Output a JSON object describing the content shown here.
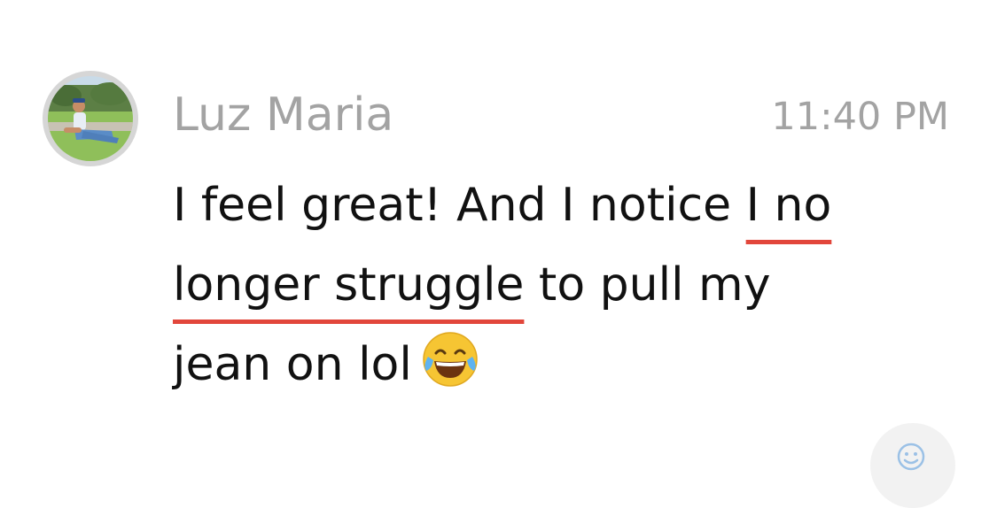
{
  "message": {
    "sender": "Luz Maria",
    "time": "11:40 PM",
    "lines": [
      {
        "before": "I feel great! And I notice ",
        "highlight": "I no",
        "after": ""
      },
      {
        "before": "",
        "highlight": "longer struggle",
        "after": " to pull my"
      },
      {
        "before": "jean on lol",
        "highlight": "",
        "after": ""
      }
    ],
    "emoji": "face-with-tears-of-joy-icon"
  },
  "colors": {
    "highlight_underline": "#e2463b",
    "meta_text": "#a3a3a3",
    "body_text": "#111111"
  },
  "icons": {
    "avatar": "avatar-photo",
    "reaction": "add-reaction-icon"
  }
}
